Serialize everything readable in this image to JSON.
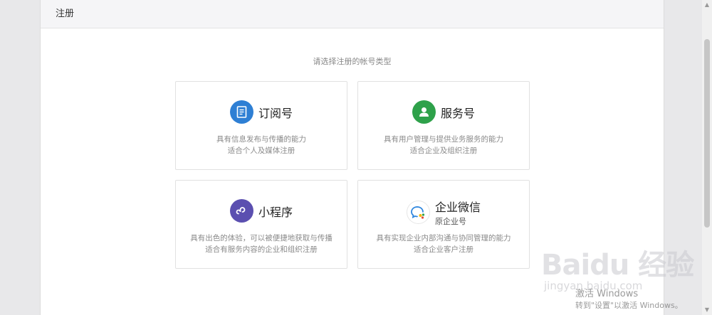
{
  "header": {
    "title": "注册"
  },
  "prompt": "请选择注册的帐号类型",
  "cards": [
    {
      "title": "订阅号",
      "desc1": "具有信息发布与传播的能力",
      "desc2": "适合个人及媒体注册",
      "icon": "document-icon",
      "color": "#2e7fd4"
    },
    {
      "title": "服务号",
      "desc1": "具有用户管理与提供业务服务的能力",
      "desc2": "适合企业及组织注册",
      "icon": "person-icon",
      "color": "#2ea14a"
    },
    {
      "title": "小程序",
      "desc1": "具有出色的体验，可以被便捷地获取与传播",
      "desc2": "适合有服务内容的企业和组织注册",
      "icon": "miniprogram-icon",
      "color": "#5b4fb0"
    },
    {
      "title": "企业微信",
      "subtitle": "原企业号",
      "desc1": "具有实现企业内部沟通与协同管理的能力",
      "desc2": "适合企业客户注册",
      "icon": "wework-icon",
      "color": "#2e86de"
    }
  ],
  "watermark": {
    "logo": "Baidu 经验",
    "url": "jingyan.baidu.com"
  },
  "activation": {
    "main": "激活 Windows",
    "sub": "转到\"设置\"以激活 Windows。"
  }
}
